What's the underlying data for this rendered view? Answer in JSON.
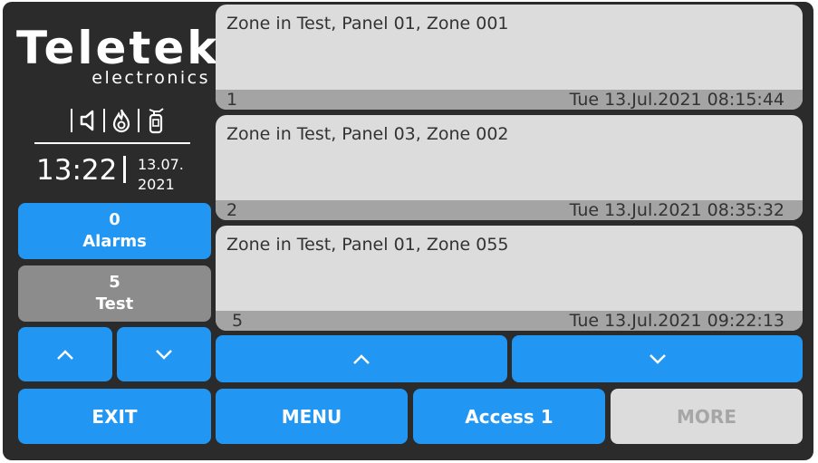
{
  "logo": {
    "brand": "Teletek",
    "sub": "electronics"
  },
  "status_icons": [
    "speaker-icon",
    "fire-icon",
    "extinguisher-icon"
  ],
  "clock": {
    "time": "13:22",
    "date_line1": "13.07.",
    "date_line2": "2021"
  },
  "counters": {
    "alarms": {
      "count": "0",
      "label": "Alarms"
    },
    "test": {
      "count": "5",
      "label": "Test"
    }
  },
  "events": [
    {
      "text": "Zone in Test, Panel 01, Zone 001",
      "number": "1",
      "timestamp": "Tue 13.Jul.2021 08:15:44"
    },
    {
      "text": "Zone in Test, Panel 03, Zone 002",
      "number": "2",
      "timestamp": "Tue 13.Jul.2021 08:35:32"
    },
    {
      "text": "Zone in Test, Panel 01, Zone 055",
      "number": "5",
      "timestamp": "Tue 13.Jul.2021 09:22:13"
    }
  ],
  "buttons": {
    "exit": "EXIT",
    "menu": "MENU",
    "access": "Access 1",
    "more": "MORE"
  },
  "colors": {
    "button_blue": "#2196f3",
    "button_gray": "#8c8c8c",
    "panel_bg": "#2b2b2b",
    "event_bg": "#dcdcdc"
  }
}
